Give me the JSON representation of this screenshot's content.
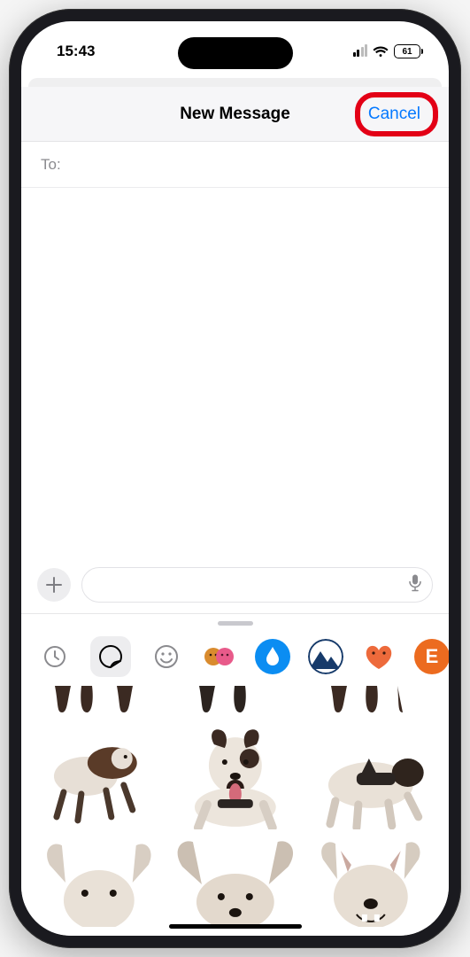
{
  "status": {
    "time": "15:43",
    "battery": "61"
  },
  "header": {
    "title": "New Message",
    "cancel": "Cancel"
  },
  "compose": {
    "to_label": "To:"
  },
  "apps": {
    "recent_name": "recent-icon",
    "stickers_name": "stickers-shape-icon",
    "memoji_name": "smiley-icon",
    "memoji_group_name": "memoji-group-icon",
    "app_water_name": "water-drop-icon",
    "app_mountain_name": "mountain-icon",
    "app_heart_name": "orange-heart-icon",
    "app_e_label": "E"
  },
  "stickers": {
    "items": [
      "dog-sticker-legs-1",
      "dog-sticker-legs-2",
      "dog-sticker-legs-3",
      "dog-sticker-play",
      "dog-sticker-tongue",
      "dog-sticker-side",
      "dog-sticker-ears-1",
      "dog-sticker-ears-2",
      "dog-sticker-face"
    ]
  }
}
